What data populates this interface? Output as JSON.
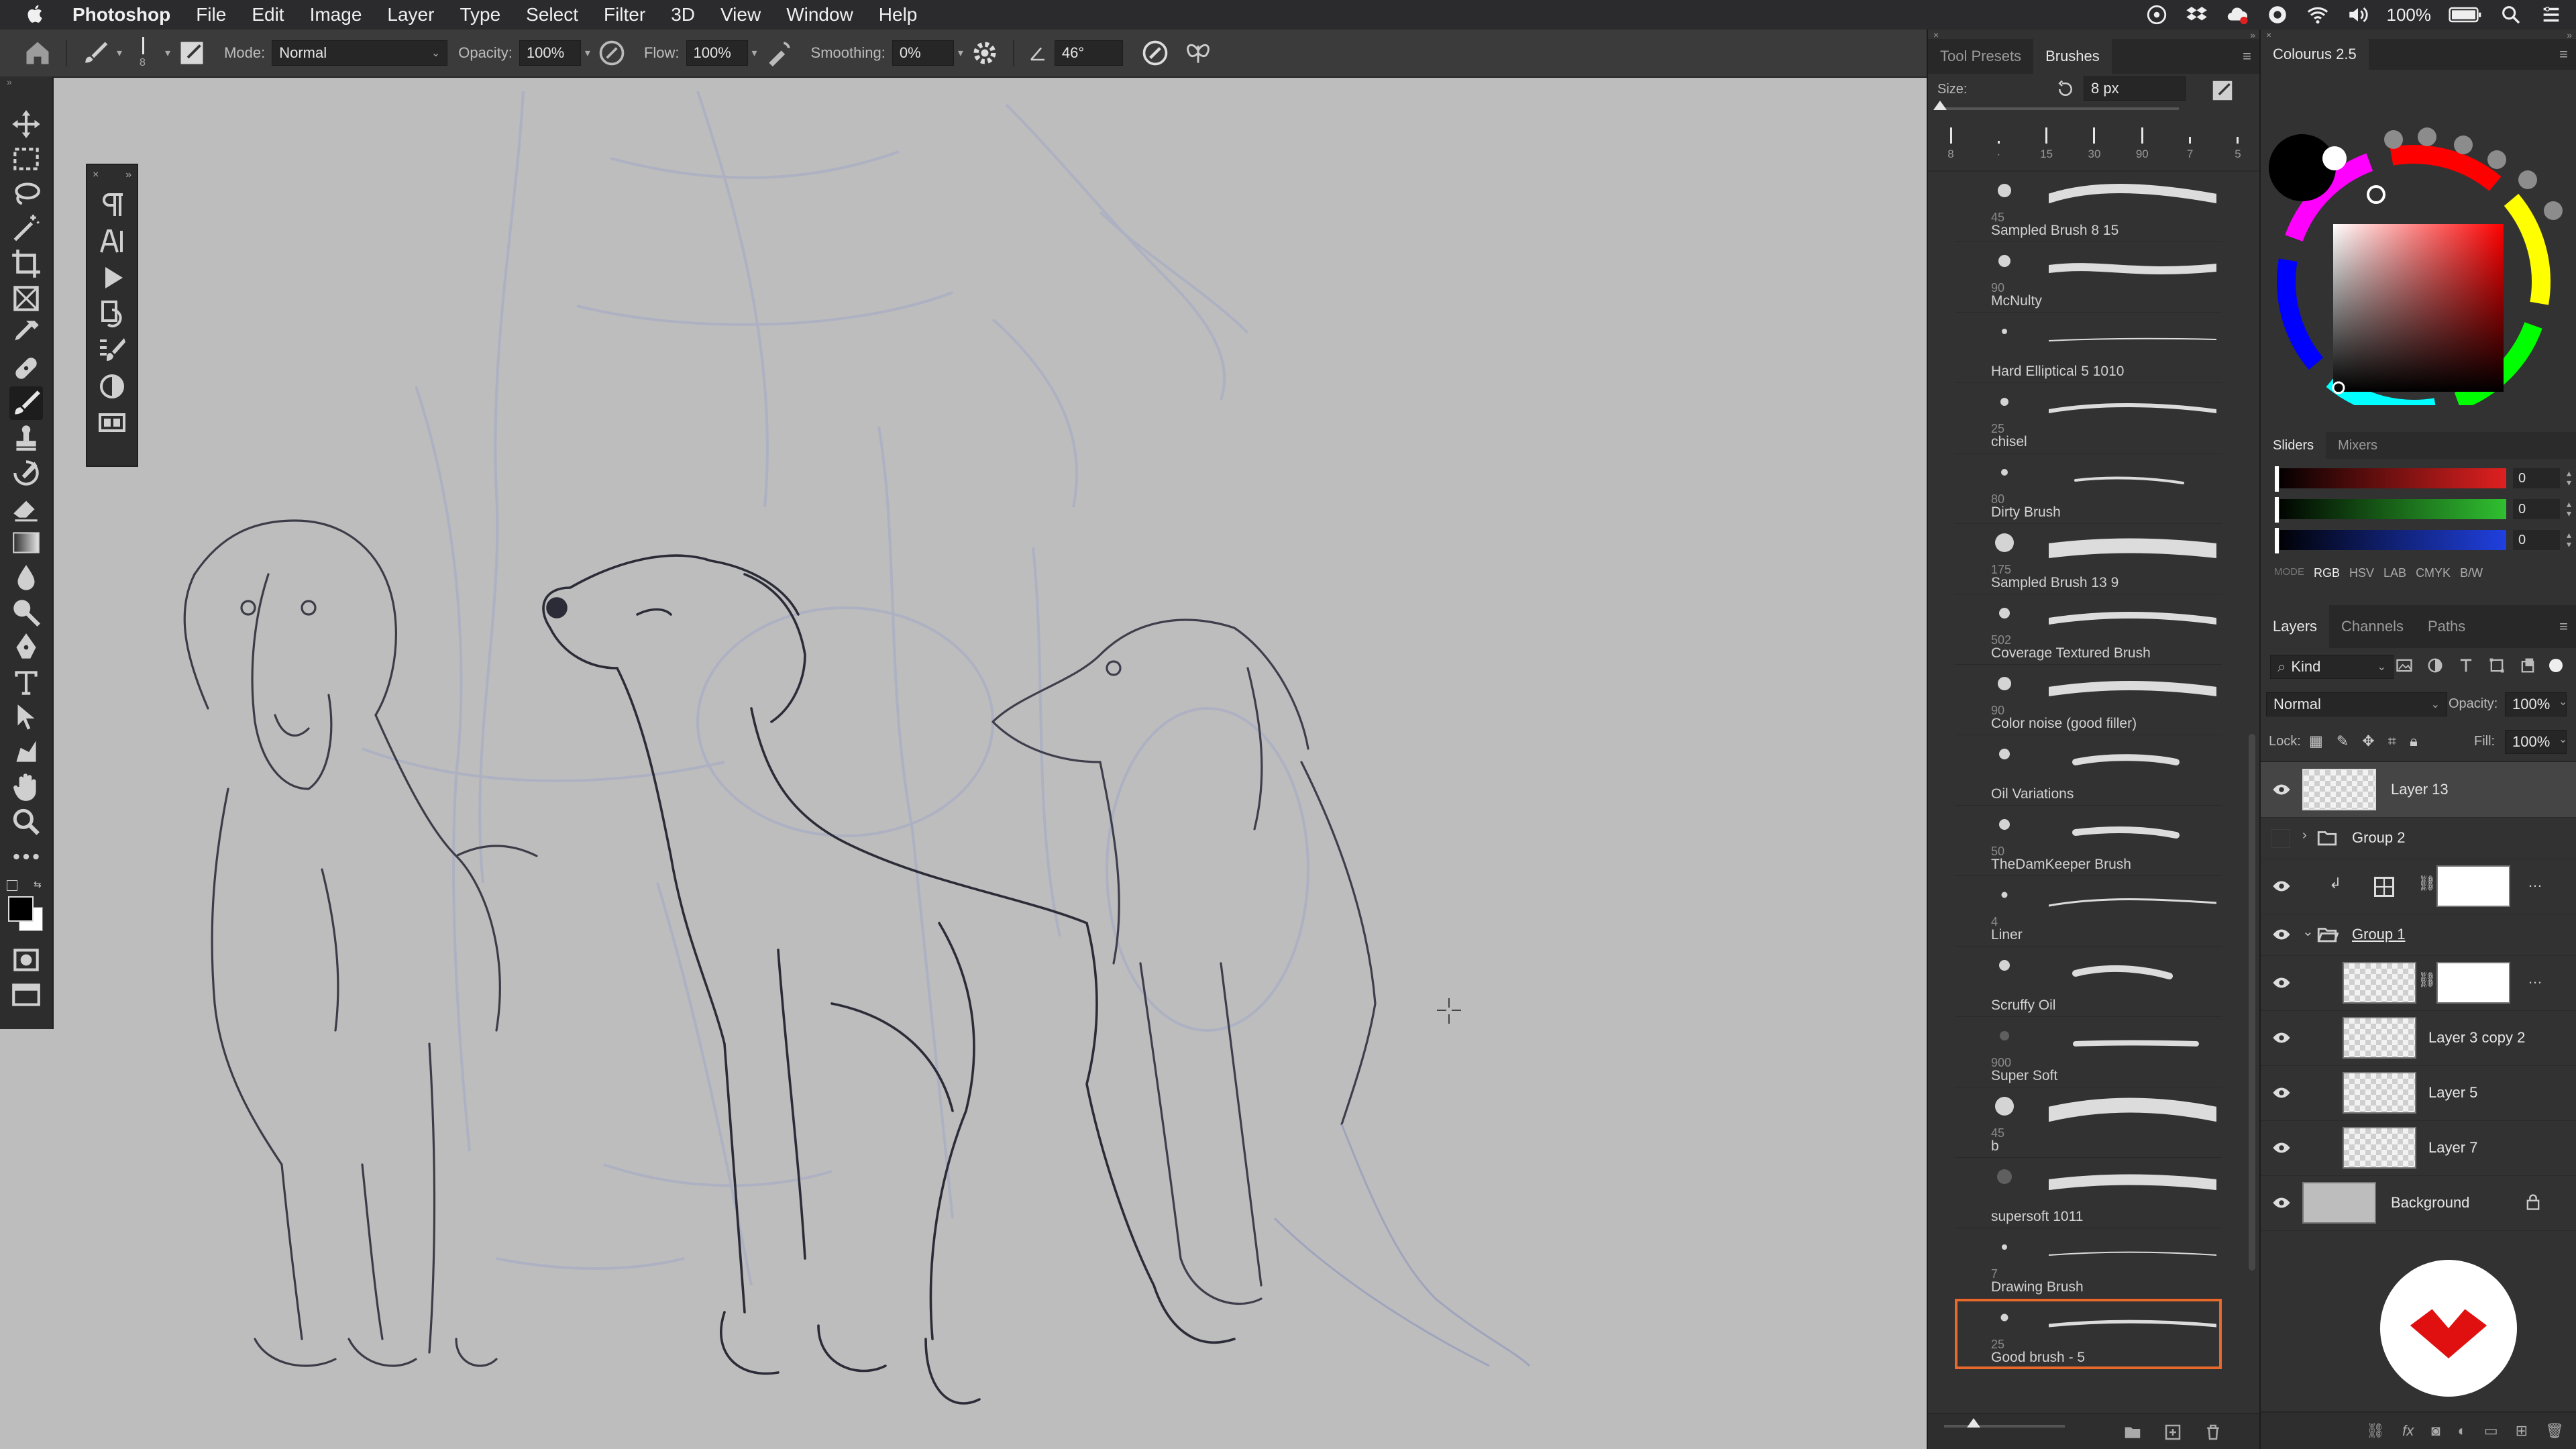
{
  "menubar": {
    "items": [
      "Photoshop",
      "File",
      "Edit",
      "Image",
      "Layer",
      "Type",
      "Select",
      "Filter",
      "3D",
      "View",
      "Window",
      "Help"
    ],
    "battery": "100%"
  },
  "options_bar": {
    "brush_size_value": "8",
    "mode_label": "Mode:",
    "mode_value": "Normal",
    "opacity_label": "Opacity:",
    "opacity_value": "100%",
    "flow_label": "Flow:",
    "flow_value": "100%",
    "smoothing_label": "Smoothing:",
    "smoothing_value": "0%",
    "angle_value": "46°"
  },
  "toolbar": {
    "tools": [
      "move",
      "marquee",
      "lasso",
      "magic-wand",
      "crop",
      "frame",
      "eyedropper",
      "healing",
      "brush",
      "stamp",
      "history-brush",
      "eraser",
      "gradient",
      "blur",
      "dodge",
      "pen",
      "type",
      "path-select",
      "shape",
      "hand",
      "zoom",
      "more"
    ]
  },
  "brushes_panel": {
    "tabs": [
      "Tool Presets",
      "Brushes"
    ],
    "active_tab": "Brushes",
    "size_label": "Size:",
    "size_value": "8 px",
    "presets": [
      "8",
      "·",
      "15",
      "30",
      "90",
      "7",
      "5"
    ],
    "preset_numbers": [
      "8",
      "15",
      "30",
      "90",
      "7",
      "5"
    ],
    "brushes": [
      {
        "num": "45",
        "name": "Sampled Brush 8 15"
      },
      {
        "num": "90",
        "name": "McNulty"
      },
      {
        "num": "",
        "name": "Hard Elliptical 5 1010"
      },
      {
        "num": "25",
        "name": "chisel"
      },
      {
        "num": "80",
        "name": "Dirty Brush"
      },
      {
        "num": "175",
        "name": "Sampled Brush 13 9"
      },
      {
        "num": "502",
        "name": "Coverage Textured Brush"
      },
      {
        "num": "90",
        "name": "Color noise (good filler)"
      },
      {
        "num": "",
        "name": "Oil Variations"
      },
      {
        "num": "50",
        "name": "TheDamKeeper Brush"
      },
      {
        "num": "4",
        "name": "Liner"
      },
      {
        "num": "",
        "name": "Scruffy Oil"
      },
      {
        "num": "900",
        "name": "Super Soft"
      },
      {
        "num": "45",
        "name": "b"
      },
      {
        "num": "",
        "name": "supersoft 1011"
      },
      {
        "num": "7",
        "name": "Drawing Brush"
      },
      {
        "num": "25",
        "name": "Good brush - 5"
      }
    ],
    "selected_brush": "Good brush - 5"
  },
  "color_panel": {
    "title": "Colourus 2.5",
    "hex": "000000",
    "slider_tabs": [
      "Sliders",
      "Mixers"
    ],
    "sliders": [
      {
        "channel": "R",
        "value": "0",
        "color": "#e02020"
      },
      {
        "channel": "G",
        "value": "0",
        "color": "#30c030"
      },
      {
        "channel": "B",
        "value": "0",
        "color": "#2040e0"
      }
    ],
    "modes_label": "MODE",
    "modes": [
      "RGB",
      "HSV",
      "LAB",
      "CMYK",
      "B/W"
    ],
    "active_mode": "RGB"
  },
  "layers_panel": {
    "tabs": [
      "Layers",
      "Channels",
      "Paths"
    ],
    "active_tab": "Layers",
    "kind_label": "Kind",
    "blend_mode": "Normal",
    "opacity_label": "Opacity:",
    "opacity_value": "100%",
    "lock_label": "Lock:",
    "fill_label": "Fill:",
    "fill_value": "100%",
    "layers": [
      {
        "name": "Layer 13",
        "type": "layer",
        "visible": true,
        "active": true
      },
      {
        "name": "Group 2",
        "type": "group",
        "visible": false,
        "expanded": false
      },
      {
        "name": "",
        "type": "adjustment",
        "visible": true
      },
      {
        "name": "Group 1",
        "type": "group",
        "visible": true,
        "expanded": true
      },
      {
        "name": "",
        "type": "masked-layer",
        "visible": true
      },
      {
        "name": "Layer 3 copy 2",
        "type": "layer",
        "visible": true
      },
      {
        "name": "Layer 5",
        "type": "layer",
        "visible": true
      },
      {
        "name": "Layer 7",
        "type": "layer",
        "visible": true
      },
      {
        "name": "Background",
        "type": "background",
        "visible": true,
        "locked": true
      }
    ]
  },
  "colors": {
    "accent_orange": "#e8692b",
    "logo_red": "#e01010",
    "panel_bg": "#323232",
    "canvas_bg": "#bdbdbd"
  }
}
